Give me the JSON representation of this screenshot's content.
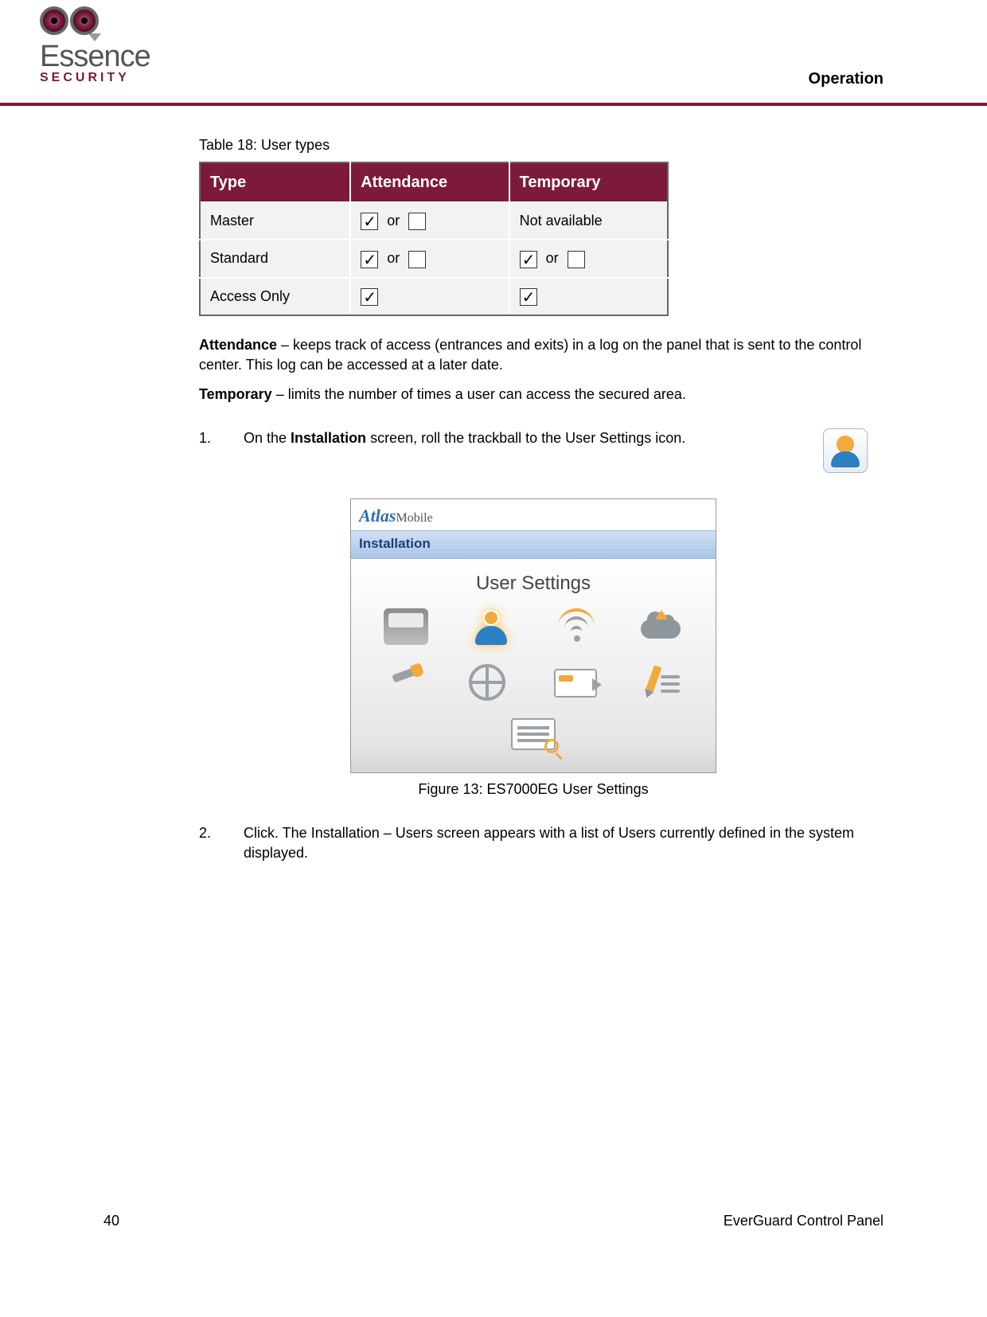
{
  "header": {
    "logo_main": "Essence",
    "logo_sub": "SECURITY",
    "section": "Operation"
  },
  "table": {
    "caption": "Table 18: User types",
    "headers": {
      "c1": "Type",
      "c2": "Attendance",
      "c3": "Temporary"
    },
    "rows": {
      "r1": {
        "type": "Master",
        "or": "or",
        "temp": "Not available"
      },
      "r2": {
        "type": "Standard",
        "or": "or",
        "or2": "or"
      },
      "r3": {
        "type": "Access Only"
      }
    }
  },
  "definitions": {
    "attendance_label": "Attendance",
    "attendance_text": " – keeps track of access (entrances and exits) in a log on the panel that is sent to the control center. This log can be accessed at a later date.",
    "temporary_label": "Temporary",
    "temporary_text": " – limits the number of times a user can access the secured area."
  },
  "steps": {
    "s1": {
      "num": "1.",
      "pre": "On the ",
      "bold": "Installation",
      "post": " screen, roll the trackball to the User Settings icon."
    },
    "s2": {
      "num": "2.",
      "text": "Click. The Installation – Users screen appears with a list of Users currently defined in the system displayed."
    }
  },
  "screenshot": {
    "brand_a": "Atlas",
    "brand_b": "Mobile",
    "subbar": "Installation",
    "screen_title": "User Settings",
    "caption": "Figure 13: ES7000EG User Settings"
  },
  "footer": {
    "page": "40",
    "doc": "EverGuard Control Panel"
  }
}
